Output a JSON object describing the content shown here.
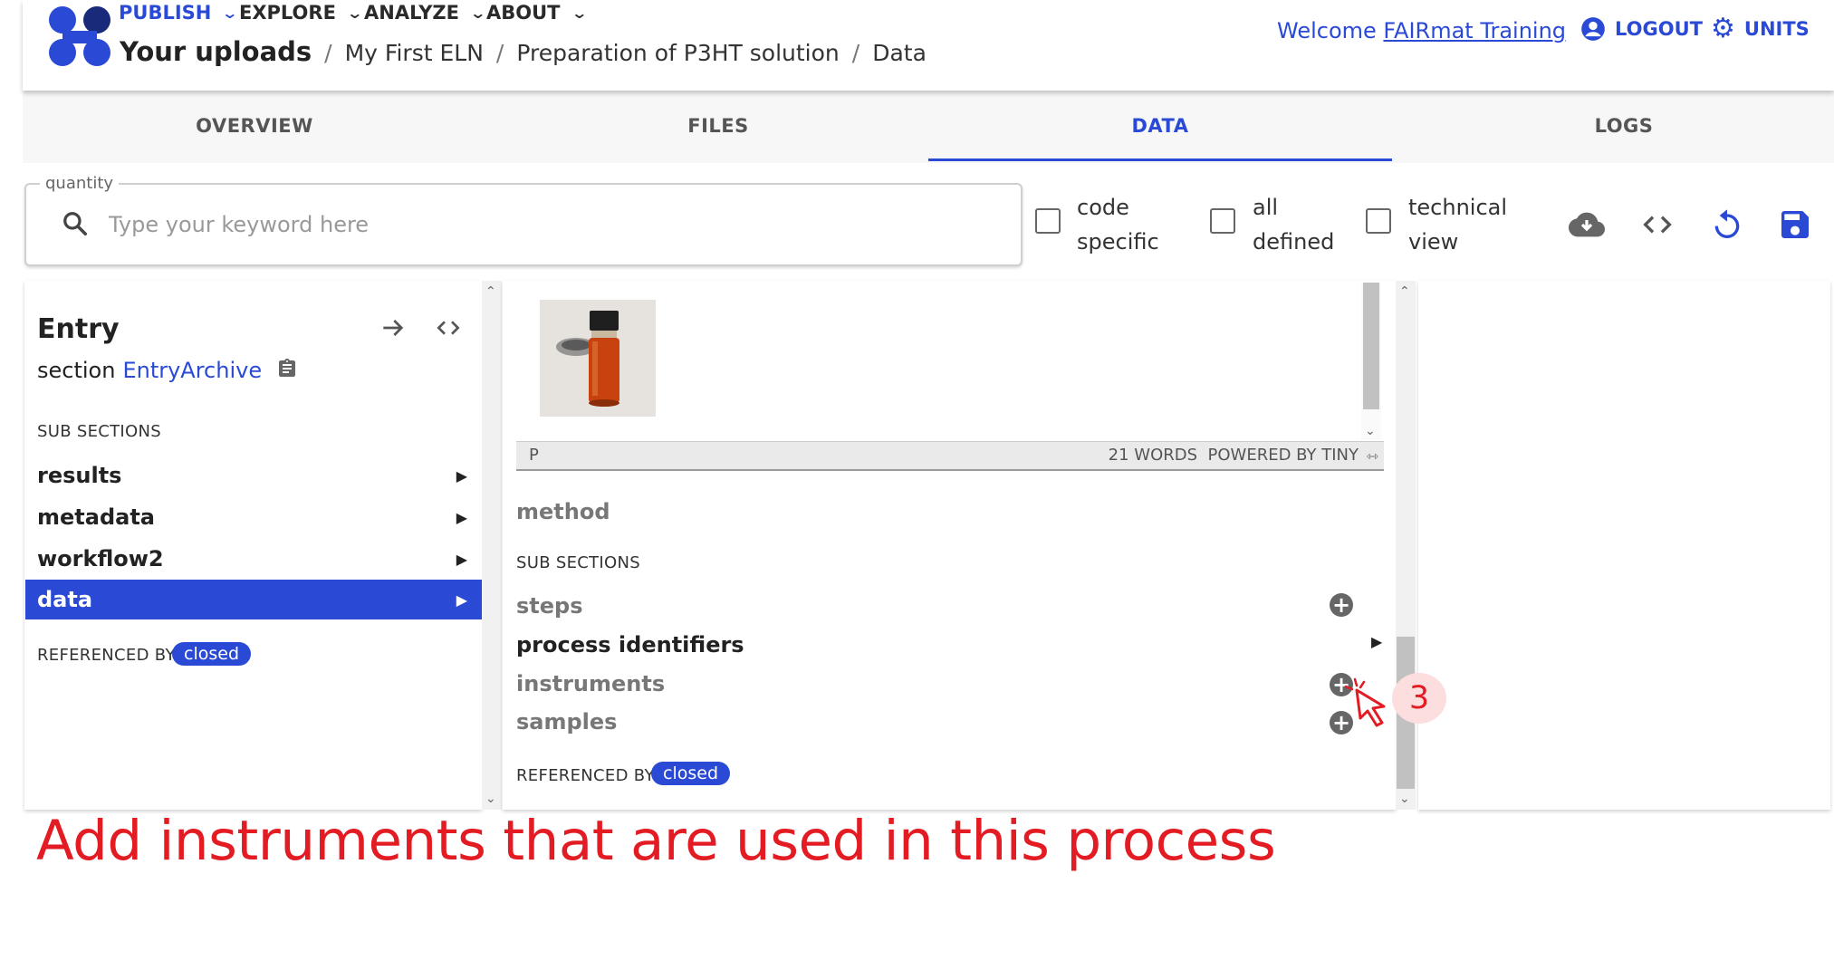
{
  "nav": {
    "menus": [
      "PUBLISH",
      "EXPLORE",
      "ANALYZE",
      "ABOUT"
    ],
    "active_menu": "PUBLISH"
  },
  "breadcrumb": {
    "root": "Your uploads",
    "items": [
      "My First ELN",
      "Preparation of P3HT solution",
      "Data"
    ],
    "separator": "/"
  },
  "header": {
    "welcome_prefix": "Welcome ",
    "user_name": "FAIRmat Training",
    "logout_label": "LOGOUT",
    "units_label": "UNITS"
  },
  "tabs": {
    "items": [
      "OVERVIEW",
      "FILES",
      "DATA",
      "LOGS"
    ],
    "active": "DATA"
  },
  "toolbar": {
    "quantity_label": "quantity",
    "search_placeholder": "Type your keyword here",
    "checkboxes": [
      {
        "line1": "code",
        "line2": "specific",
        "checked": false
      },
      {
        "line1": "all",
        "line2": "defined",
        "checked": false
      },
      {
        "line1": "technical",
        "line2": "view",
        "checked": false
      }
    ],
    "icons": [
      "cloud-download-icon",
      "code-icon",
      "reload-icon",
      "save-icon"
    ]
  },
  "left_pane": {
    "title": "Entry",
    "section_label": "section",
    "section_link": "EntryArchive",
    "subsections_heading": "SUB SECTIONS",
    "items": [
      {
        "label": "results",
        "selected": false
      },
      {
        "label": "metadata",
        "selected": false
      },
      {
        "label": "workflow2",
        "selected": false
      },
      {
        "label": "data",
        "selected": true
      }
    ],
    "referenced_by_label": "REFERENCED BY",
    "referenced_by_badge": "closed"
  },
  "middle_pane": {
    "editor_status_left": "P",
    "editor_status_right": "21 WORDS  POWERED BY TINY",
    "method_label": "method",
    "subsections_heading": "SUB SECTIONS",
    "items": [
      {
        "label": "steps",
        "action": "add"
      },
      {
        "label": "process identifiers",
        "action": "expand"
      },
      {
        "label": "instruments",
        "action": "add"
      },
      {
        "label": "samples",
        "action": "add"
      }
    ],
    "referenced_by_label": "REFERENCED BY",
    "referenced_by_badge": "closed"
  },
  "annotation": {
    "text": "Add instruments that are used in this process",
    "step_number": "3",
    "color": "#e31b23"
  },
  "colors": {
    "accent": "#2a4ad6",
    "annotation": "#e31b23"
  }
}
